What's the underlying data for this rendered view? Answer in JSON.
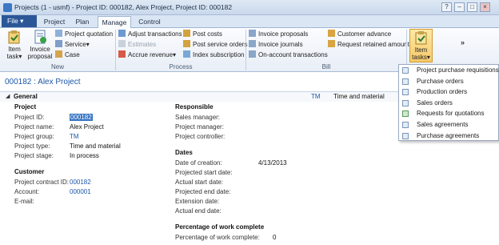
{
  "window": {
    "title": "Projects (1 - usmf) - Project ID: 000182, Alex Project, Project ID: 000182",
    "controls": [
      "?",
      "–",
      "□",
      "×"
    ]
  },
  "tabs": {
    "file": "File",
    "items": [
      "Project",
      "Plan",
      "Manage",
      "Control"
    ]
  },
  "ribbon": {
    "new": {
      "label": "New",
      "item_task": "Item\ntask",
      "item_task_1": "Item",
      "item_task_2": "task",
      "invoice_proposal_1": "Invoice",
      "invoice_proposal_2": "proposal",
      "project_quotation": "Project quotation",
      "service": "Service",
      "case": "Case"
    },
    "process": {
      "label": "Process",
      "adjust_transactions": "Adjust transactions",
      "estimates": "Estimates",
      "accrue_revenue": "Accrue revenue",
      "post_costs": "Post costs",
      "post_service_orders": "Post service orders",
      "index_subscription": "Index subscription"
    },
    "bill": {
      "label": "Bill",
      "invoice_proposals": "Invoice proposals",
      "invoice_journals": "Invoice journals",
      "on_account_transactions": "On-account transactions",
      "customer_advance": "Customer advance",
      "request_retained_amount": "Request retained amount"
    },
    "item_tasks_1": "Item",
    "item_tasks_2": "tasks",
    "overflow": "»"
  },
  "form": {
    "title": "000182 : Alex Project",
    "section": "General",
    "summary_tm": "TM",
    "summary_type": "Time and material"
  },
  "project": {
    "heading": "Project",
    "id_label": "Project ID:",
    "id_value": "000182",
    "name_label": "Project name:",
    "name_value": "Alex Project",
    "group_label": "Project group:",
    "group_value": "TM",
    "type_label": "Project type:",
    "type_value": "Time and material",
    "stage_label": "Project stage:",
    "stage_value": "In process"
  },
  "customer": {
    "heading": "Customer",
    "contract_label": "Project contract ID:",
    "contract_value": "000182",
    "account_label": "Account:",
    "account_value": "000001",
    "email_label": "E-mail:"
  },
  "responsible": {
    "heading": "Responsible",
    "sales_label": "Sales manager:",
    "pm_label": "Project manager:",
    "pc_label": "Project controller:"
  },
  "dates": {
    "heading": "Dates",
    "creation_label": "Date of creation:",
    "creation_value": "4/13/2013",
    "proj_start": "Projected start date:",
    "act_start": "Actual start date:",
    "proj_end": "Projected end date:",
    "ext": "Extension date:",
    "act_end": "Actual end date:"
  },
  "pct": {
    "heading": "Percentage of work complete",
    "label": "Percentage of work complete:",
    "value": "0"
  },
  "dropdown": [
    "Project purchase requisitions",
    "Purchase orders",
    "Production orders",
    "Sales orders",
    "Requests for quotations",
    "Sales agreements",
    "Purchase agreements"
  ]
}
